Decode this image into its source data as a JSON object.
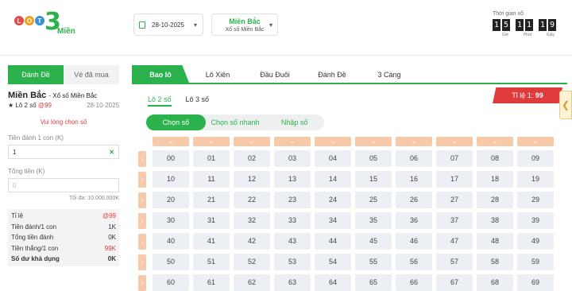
{
  "logo": {
    "balls": [
      "L",
      "O"
    ],
    "number": "3",
    "text": "Miền",
    "colors": [
      "#e8494b",
      "#f0a21b",
      "#3a8fd9"
    ]
  },
  "date_picker": {
    "value": "28-10-2025",
    "icon": "calendar-icon"
  },
  "region": {
    "title": "Miền Bắc",
    "subtitle": "Xổ số Miền Bắc"
  },
  "timer": {
    "label": "Thời gian xổ",
    "digits": [
      "1",
      "5",
      "1",
      "1",
      "1",
      "9"
    ],
    "units": [
      "Giờ",
      "Phút",
      "Giây"
    ]
  },
  "left": {
    "tabs": [
      "Đánh Đề",
      "Vé đã mua"
    ],
    "title": "Miền Bắc",
    "title_suffix": "- Xổ số Miền Bắc",
    "bet_type": "★ Lô 2 số",
    "bet_rate": "@99",
    "date": "28-10-2025",
    "prompt": "Vui lòng chọn số",
    "per_label": "Tiền đánh 1 con (K)",
    "per_value": "1",
    "total_label": "Tổng tiền (K)",
    "total_placeholder": "0",
    "max": "Tối đa: 10.000.000K",
    "summary": [
      {
        "label": "Tỉ lệ",
        "value": "@99",
        "red": true
      },
      {
        "label": "Tiền đánh/1 con",
        "value": "1K"
      },
      {
        "label": "Tổng tiền đánh",
        "value": "0K"
      },
      {
        "label": "Tiền thắng/1 con",
        "value": "99K",
        "red": true
      },
      {
        "label": "Số dư khả dụng",
        "value": "0K",
        "bold": true
      }
    ]
  },
  "main": {
    "tabs": [
      "Bao lô",
      "Lô Xiên",
      "Đầu Đuôi",
      "Đánh Đề",
      "3 Càng"
    ],
    "ratio_label": "Tỉ lệ 1:",
    "ratio_value": "99",
    "subtabs": [
      "Lô 2 số",
      "Lô 3 số"
    ],
    "modes": [
      "Chọn số",
      "Chọn số nhanh",
      "Nhập số"
    ],
    "rows": [
      [
        "00",
        "01",
        "02",
        "03",
        "04",
        "05",
        "06",
        "07",
        "08",
        "09"
      ],
      [
        "10",
        "11",
        "12",
        "13",
        "14",
        "15",
        "16",
        "17",
        "18",
        "19"
      ],
      [
        "20",
        "21",
        "22",
        "23",
        "24",
        "25",
        "26",
        "27",
        "28",
        "29"
      ],
      [
        "30",
        "31",
        "32",
        "33",
        "34",
        "35",
        "36",
        "37",
        "38",
        "39"
      ],
      [
        "40",
        "41",
        "42",
        "43",
        "44",
        "45",
        "46",
        "47",
        "48",
        "49"
      ],
      [
        "50",
        "51",
        "52",
        "53",
        "54",
        "55",
        "56",
        "57",
        "58",
        "59"
      ],
      [
        "60",
        "61",
        "62",
        "63",
        "64",
        "65",
        "66",
        "67",
        "68",
        "69"
      ]
    ]
  },
  "accent_color": "#2bb24c",
  "alert_color": "#e03a3a"
}
